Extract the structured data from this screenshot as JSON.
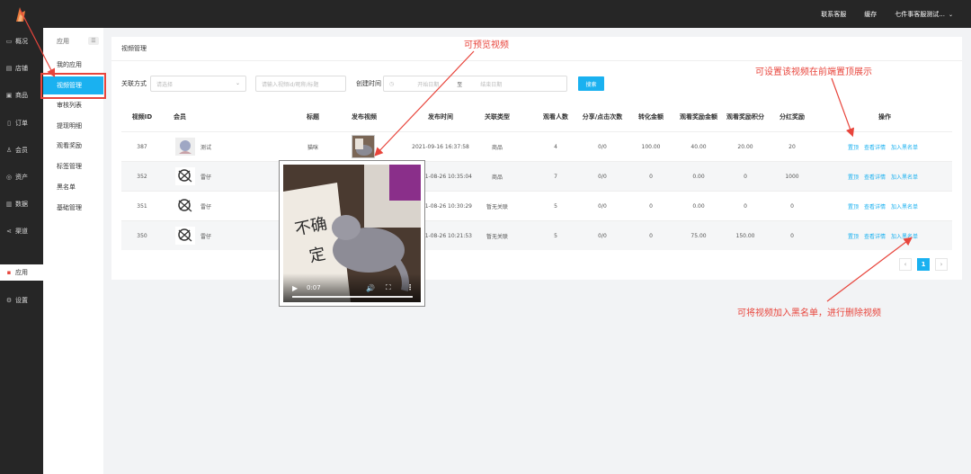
{
  "topbar": {
    "links": [
      "联系客服",
      "缓存"
    ],
    "user": "七件事客服测试...",
    "caret": "⌄"
  },
  "sidebar": {
    "items": [
      {
        "icon": "monitor-icon",
        "glyph": "▭",
        "label": "概况"
      },
      {
        "icon": "store-icon",
        "glyph": "▤",
        "label": "店铺"
      },
      {
        "icon": "goods-icon",
        "glyph": "▣",
        "label": "商品"
      },
      {
        "icon": "order-icon",
        "glyph": "▯",
        "label": "订单"
      },
      {
        "icon": "member-icon",
        "glyph": "♙",
        "label": "会员"
      },
      {
        "icon": "asset-icon",
        "glyph": "◎",
        "label": "资产"
      },
      {
        "icon": "data-icon",
        "glyph": "▥",
        "label": "数据"
      },
      {
        "icon": "channel-icon",
        "glyph": "⋖",
        "label": "渠道"
      },
      {
        "icon": "app-icon",
        "glyph": "▪",
        "label": "应用"
      },
      {
        "icon": "settings-icon",
        "glyph": "⚙",
        "label": "设置"
      }
    ]
  },
  "submenu": {
    "head": "应用",
    "toggle": "☰",
    "items": [
      "我的应用",
      "视频管理",
      "审核列表",
      "提现明细",
      "观看奖励",
      "标签管理",
      "黑名单",
      "基础管理"
    ]
  },
  "main": {
    "title": "视频管理",
    "filters": {
      "relation_label": "关联方式",
      "relation_placeholder": "请选择",
      "keyword_placeholder": "请输入视频id/昵称/标题",
      "created_label": "创建时间",
      "start_placeholder": "开始日期",
      "to": "至",
      "end_placeholder": "结束日期",
      "search": "搜索"
    },
    "columns": [
      "视频ID",
      "会员",
      "标题",
      "发布视频",
      "发布时间",
      "关联类型",
      "观看人数",
      "分享/点击次数",
      "转化金额",
      "观看奖励金额",
      "观看奖励积分",
      "分红奖励",
      "操作"
    ],
    "rows": [
      {
        "id": "387",
        "member": "测试",
        "title": "猫咪",
        "time": "2021-09-16 16:37:58",
        "type": "商品",
        "viewers": "4",
        "share": "0/0",
        "conv": "100.00",
        "reward_amt": "40.00",
        "reward_pts": "20.00",
        "bonus": "20"
      },
      {
        "id": "352",
        "member": "雷仔",
        "title": "",
        "time": "2021-08-26 10:35:04",
        "type": "商品",
        "viewers": "7",
        "share": "0/0",
        "conv": "0",
        "reward_amt": "0.00",
        "reward_pts": "0",
        "bonus": "1000"
      },
      {
        "id": "351",
        "member": "雷仔",
        "title": "",
        "time": "2021-08-26 10:30:29",
        "type": "暂无关联",
        "viewers": "5",
        "share": "0/0",
        "conv": "0",
        "reward_amt": "0.00",
        "reward_pts": "0",
        "bonus": "0"
      },
      {
        "id": "350",
        "member": "雷仔",
        "title": "",
        "time": "2021-08-26 10:21:53",
        "type": "暂无关联",
        "viewers": "5",
        "share": "0/0",
        "conv": "0",
        "reward_amt": "75.00",
        "reward_pts": "150.00",
        "bonus": "0"
      }
    ],
    "ops": [
      "置顶",
      "查看详情",
      "加入黑名单"
    ],
    "pager": {
      "prev": "‹",
      "current": "1",
      "next": "›"
    }
  },
  "preview": {
    "play": "▶",
    "time": "0:07",
    "volume": "🔊",
    "fullscreen": "⛶",
    "more": "⋮"
  },
  "annotations": {
    "preview_note": "可预览视频",
    "top_note": "可设置该视频在前端置顶展示",
    "blacklist_note": "可将视频加入黑名单，进行删除视频"
  },
  "colors": {
    "accent": "#1ab1f0",
    "annotation": "#e8453c",
    "dark": "#262626"
  }
}
